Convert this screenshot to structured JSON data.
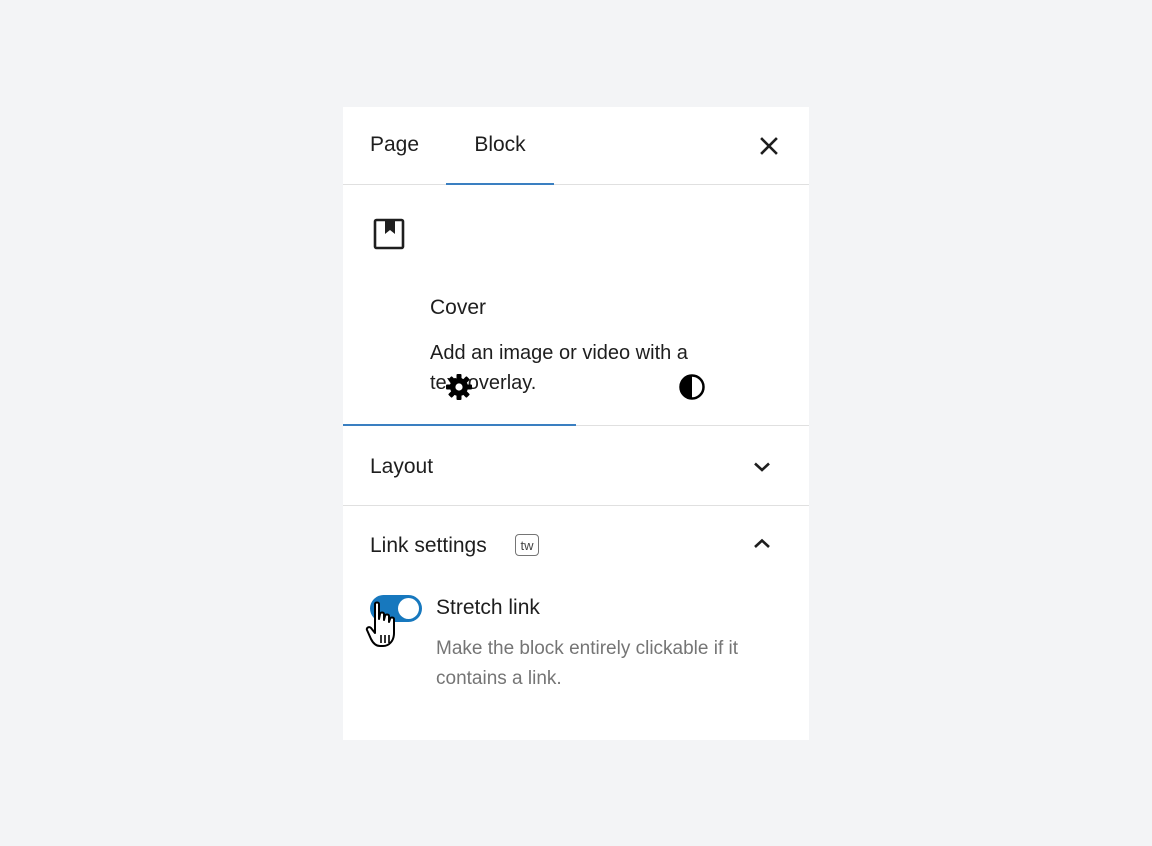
{
  "sidebar_tabs": [
    {
      "label": "Page"
    },
    {
      "label": "Block",
      "active": true
    }
  ],
  "close_icon": "close-icon",
  "block": {
    "icon": "cover-block-icon",
    "title": "Cover",
    "description_lines": [
      "Add an image or video with a",
      "text overlay."
    ]
  },
  "inspector_tabs": [
    {
      "icon": "gear-icon",
      "active": true
    },
    {
      "icon": "contrast-icon",
      "active": false
    }
  ],
  "panels": {
    "layout": {
      "title": "Layout",
      "expanded": false,
      "icon": "chevron-down-icon"
    },
    "link_settings": {
      "title": "Link settings",
      "badge": "tw",
      "expanded": true,
      "icon": "chevron-up-icon",
      "toggle": {
        "label": "Stretch link",
        "checked": true,
        "help_lines": [
          "Make the block entirely clickable if it",
          "contains a link."
        ]
      }
    }
  },
  "colors": {
    "accent": "#3a7fc1",
    "toggle_on": "#1778be",
    "background": "#f3f4f6"
  }
}
